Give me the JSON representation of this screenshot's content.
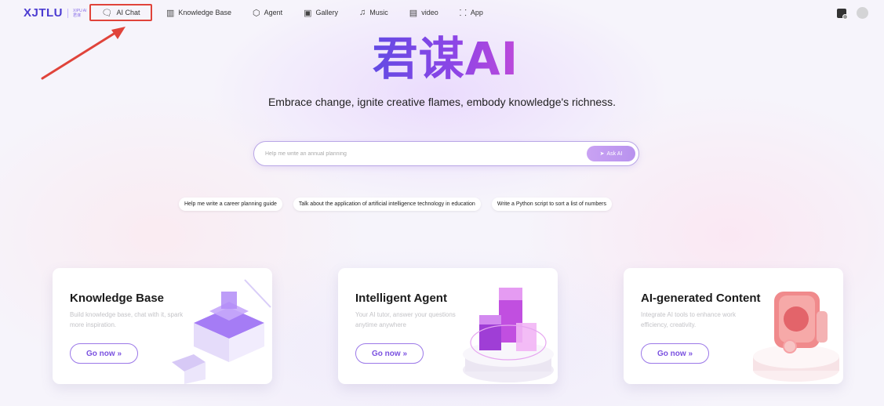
{
  "brand": {
    "name": "XJTLU",
    "sub": "XIPU AI 君谋"
  },
  "nav": [
    {
      "label": "AI Chat",
      "icon": "chat-icon",
      "glyph": "🗨"
    },
    {
      "label": "Knowledge Base",
      "icon": "book-icon",
      "glyph": "▥"
    },
    {
      "label": "Agent",
      "icon": "cube-icon",
      "glyph": "⬡"
    },
    {
      "label": "Gallery",
      "icon": "image-icon",
      "glyph": "▣"
    },
    {
      "label": "Music",
      "icon": "music-icon",
      "glyph": "♫"
    },
    {
      "label": "video",
      "icon": "video-icon",
      "glyph": "▤"
    },
    {
      "label": "App",
      "icon": "apps-icon",
      "glyph": "⸬"
    }
  ],
  "hero": {
    "logo_text": "君谋AI",
    "tagline": "Embrace change, ignite creative flames, embody knowledge's richness."
  },
  "search": {
    "placeholder": "Help me write an annual planning",
    "value": "",
    "button_label": "Ask AI",
    "button_icon": "send-icon"
  },
  "suggestions": [
    "Help me write a career planning guide",
    "Talk about the application of artificial intelligence technology in education",
    "Write a Python script to sort a list of numbers"
  ],
  "cards": [
    {
      "title": "Knowledge Base",
      "desc": "Build knowledge base, chat with it, spark more inspiration.",
      "button": "Go now »"
    },
    {
      "title": "Intelligent Agent",
      "desc": "Your AI tutor, answer your questions anytime anywhere",
      "button": "Go now »"
    },
    {
      "title": "AI-generated Content",
      "desc": "Integrate AI tools to enhance work efficiency, creativity.",
      "button": "Go now »"
    }
  ],
  "colors": {
    "annotation": "#e0433a",
    "accent": "#7a51e0",
    "brand": "#4b3bd1"
  }
}
